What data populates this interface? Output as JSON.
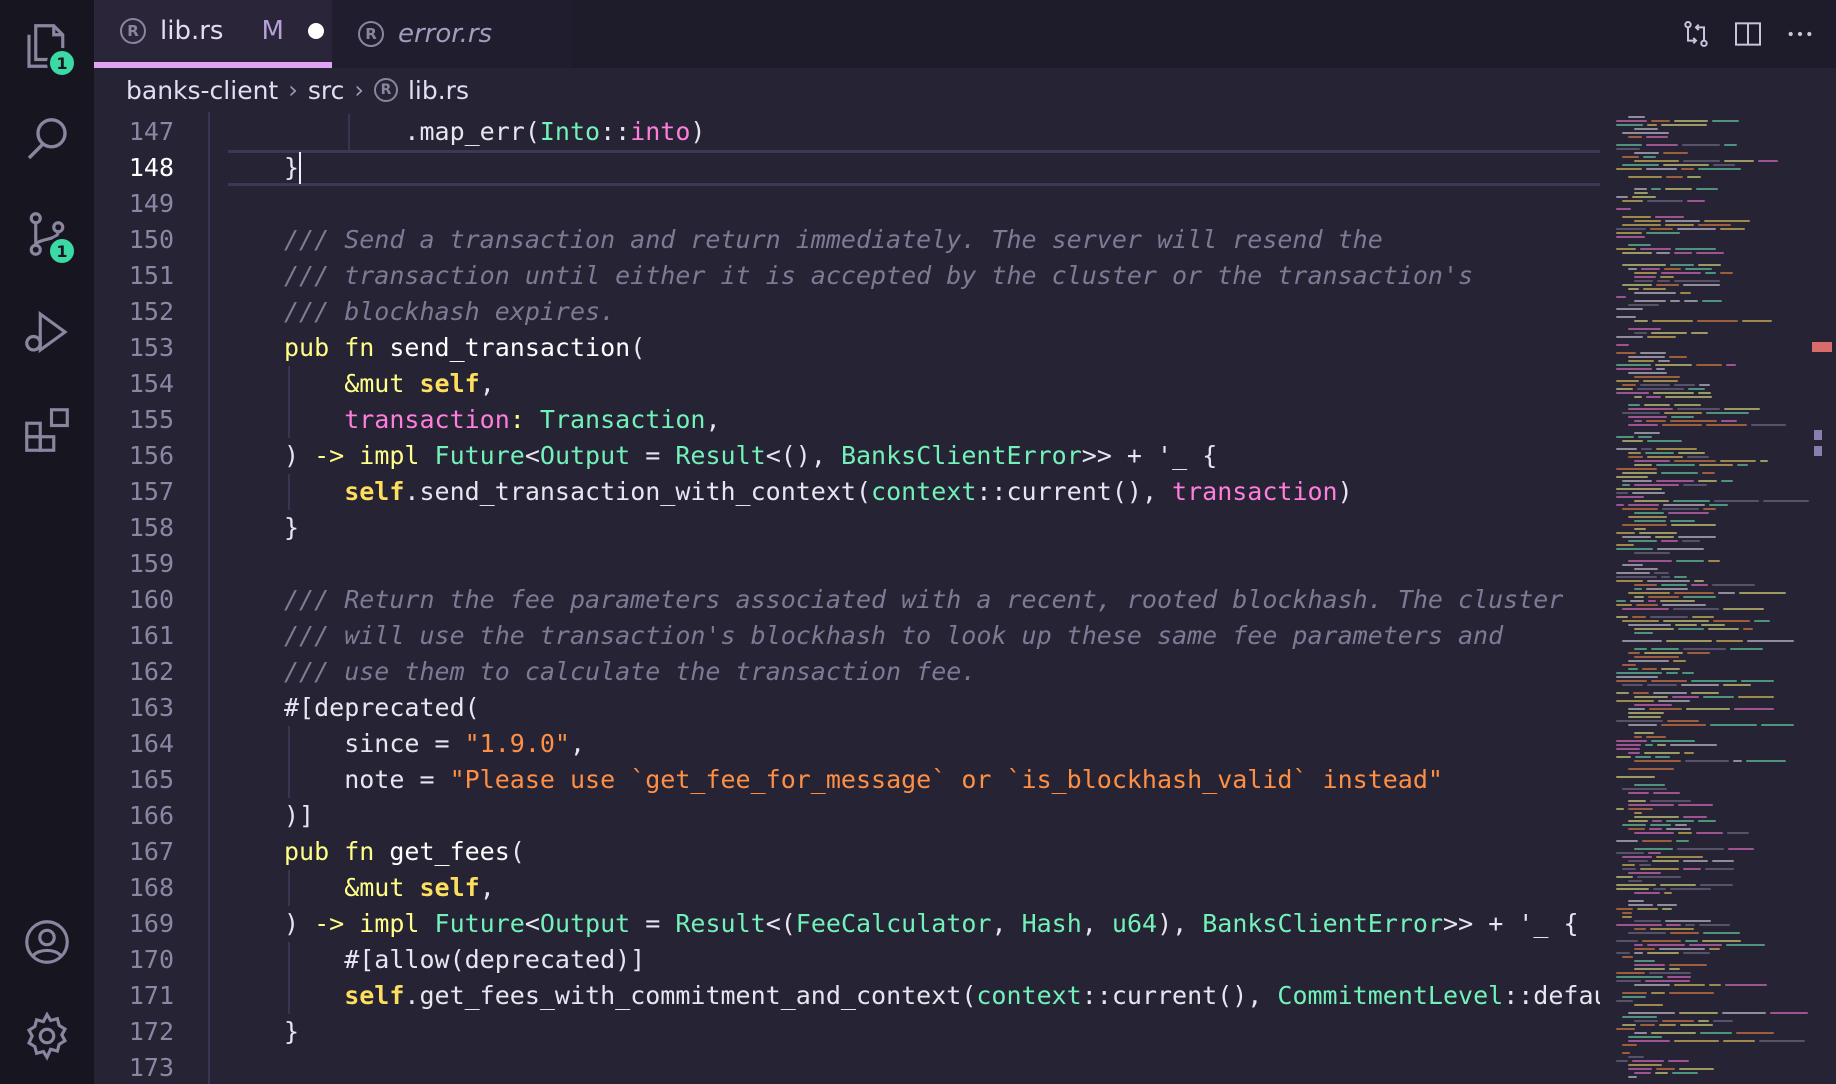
{
  "activity_bar": {
    "explorer_badge": "1",
    "source_control_badge": "1"
  },
  "tabs": [
    {
      "label": "lib.rs",
      "modified": "M",
      "icon": "R"
    },
    {
      "label": "error.rs",
      "icon": "R"
    }
  ],
  "breadcrumb": {
    "items": [
      "banks-client",
      "src",
      "lib.rs"
    ],
    "file_icon": "R"
  },
  "editor": {
    "active_line": "148",
    "line_numbers": [
      "147",
      "148",
      "149",
      "150",
      "151",
      "152",
      "153",
      "154",
      "155",
      "156",
      "157",
      "158",
      "159",
      "160",
      "161",
      "162",
      "163",
      "164",
      "165",
      "166",
      "167",
      "168",
      "169",
      "170",
      "171",
      "172",
      "173"
    ],
    "lines": [
      [
        {
          "c": "p",
          "t": "        .map_err("
        },
        {
          "c": "t",
          "t": "Into"
        },
        {
          "c": "p",
          "t": "::"
        },
        {
          "c": "v",
          "t": "into"
        },
        {
          "c": "p",
          "t": ")"
        }
      ],
      [
        {
          "c": "p",
          "t": "}"
        }
      ],
      [],
      [
        {
          "c": "c",
          "t": "/// Send a transaction and return immediately. The server will resend the"
        }
      ],
      [
        {
          "c": "c",
          "t": "/// transaction until either it is accepted by the cluster or the transaction's"
        }
      ],
      [
        {
          "c": "c",
          "t": "/// blockhash expires."
        }
      ],
      [
        {
          "c": "k",
          "t": "pub fn "
        },
        {
          "c": "f",
          "t": "send_transaction"
        },
        {
          "c": "p",
          "t": "("
        }
      ],
      [
        {
          "c": "k",
          "t": "    &mut "
        },
        {
          "c": "sf",
          "t": "self"
        },
        {
          "c": "p",
          "t": ","
        }
      ],
      [
        {
          "c": "v",
          "t": "    transaction"
        },
        {
          "c": "k",
          "t": ": "
        },
        {
          "c": "t",
          "t": "Transaction"
        },
        {
          "c": "p",
          "t": ","
        }
      ],
      [
        {
          "c": "p",
          "t": ") "
        },
        {
          "c": "k",
          "t": "-> impl "
        },
        {
          "c": "t",
          "t": "Future"
        },
        {
          "c": "p",
          "t": "<"
        },
        {
          "c": "t",
          "t": "Output"
        },
        {
          "c": "p",
          "t": " = "
        },
        {
          "c": "t",
          "t": "Result"
        },
        {
          "c": "p",
          "t": "<(), "
        },
        {
          "c": "t",
          "t": "BanksClientError"
        },
        {
          "c": "p",
          "t": ">> + '_ {"
        }
      ],
      [
        {
          "c": "sf",
          "t": "    self"
        },
        {
          "c": "p",
          "t": ".send_transaction_with_context("
        },
        {
          "c": "t",
          "t": "context"
        },
        {
          "c": "p",
          "t": "::current(), "
        },
        {
          "c": "v",
          "t": "transaction"
        },
        {
          "c": "p",
          "t": ")"
        }
      ],
      [
        {
          "c": "p",
          "t": "}"
        }
      ],
      [],
      [
        {
          "c": "c",
          "t": "/// Return the fee parameters associated with a recent, rooted blockhash. The cluster"
        }
      ],
      [
        {
          "c": "c",
          "t": "/// will use the transaction's blockhash to look up these same fee parameters and"
        }
      ],
      [
        {
          "c": "c",
          "t": "/// use them to calculate the transaction fee."
        }
      ],
      [
        {
          "c": "p",
          "t": "#[deprecated("
        }
      ],
      [
        {
          "c": "p",
          "t": "    since = "
        },
        {
          "c": "s",
          "t": "\"1.9.0\""
        },
        {
          "c": "p",
          "t": ","
        }
      ],
      [
        {
          "c": "p",
          "t": "    note = "
        },
        {
          "c": "s",
          "t": "\"Please use `get_fee_for_message` or `is_blockhash_valid` instead\""
        }
      ],
      [
        {
          "c": "p",
          "t": ")]"
        }
      ],
      [
        {
          "c": "k",
          "t": "pub fn "
        },
        {
          "c": "f",
          "t": "get_fees"
        },
        {
          "c": "p",
          "t": "("
        }
      ],
      [
        {
          "c": "k",
          "t": "    &mut "
        },
        {
          "c": "sf",
          "t": "self"
        },
        {
          "c": "p",
          "t": ","
        }
      ],
      [
        {
          "c": "p",
          "t": ") "
        },
        {
          "c": "k",
          "t": "-> impl "
        },
        {
          "c": "t",
          "t": "Future"
        },
        {
          "c": "p",
          "t": "<"
        },
        {
          "c": "t",
          "t": "Output"
        },
        {
          "c": "p",
          "t": " = "
        },
        {
          "c": "t",
          "t": "Result"
        },
        {
          "c": "p",
          "t": "<("
        },
        {
          "c": "t",
          "t": "FeeCalculator"
        },
        {
          "c": "p",
          "t": ", "
        },
        {
          "c": "t",
          "t": "Hash"
        },
        {
          "c": "p",
          "t": ", "
        },
        {
          "c": "t",
          "t": "u64"
        },
        {
          "c": "p",
          "t": "), "
        },
        {
          "c": "t",
          "t": "BanksClientError"
        },
        {
          "c": "p",
          "t": ">> + '_ {"
        }
      ],
      [
        {
          "c": "p",
          "t": "    #[allow(deprecated)]"
        }
      ],
      [
        {
          "c": "sf",
          "t": "    self"
        },
        {
          "c": "p",
          "t": ".get_fees_with_commitment_and_context("
        },
        {
          "c": "t",
          "t": "context"
        },
        {
          "c": "p",
          "t": "::current(), "
        },
        {
          "c": "t",
          "t": "CommitmentLevel"
        },
        {
          "c": "p",
          "t": "::default("
        }
      ],
      [
        {
          "c": "p",
          "t": "}"
        }
      ],
      []
    ]
  },
  "colors": {
    "background": "#262335",
    "activity_bar": "#171520",
    "comment": "#7f7a94",
    "keyword": "#fefe88",
    "string": "#fe8f43",
    "type": "#72f1b8",
    "variable": "#ff7edb",
    "self": "#fede5d",
    "badge": "#3bd9a3",
    "tab_active_border": "#e1a4f5"
  },
  "icons": {
    "activity": [
      "files-icon",
      "search-icon",
      "source-control-icon",
      "run-debug-icon",
      "extensions-icon",
      "account-icon",
      "settings-gear-icon"
    ],
    "tab_actions": [
      "open-changes-icon",
      "split-editor-icon",
      "more-actions-icon"
    ]
  }
}
